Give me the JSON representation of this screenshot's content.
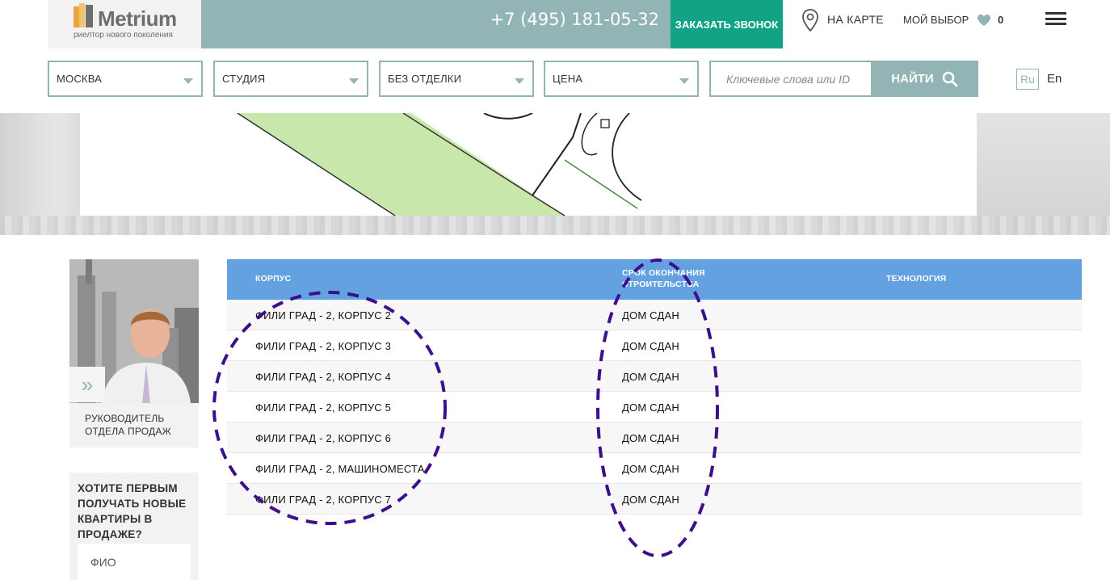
{
  "header": {
    "logo_name": "Metrium",
    "logo_tagline": "риелтор нового поколения",
    "phone": "+7 (495) 181-05-32",
    "call_button": "ЗАКАЗАТЬ ЗВОНОК",
    "map_link": "НА КАРТЕ",
    "my_choice": "МОЙ ВЫБОР",
    "choice_count": "0",
    "colors": {
      "teal": "#93b4b5",
      "green": "#12a286",
      "blue": "#64a1e0"
    }
  },
  "filters": {
    "city": "МОСКВА",
    "rooms": "СТУДИЯ",
    "finish": "БЕЗ ОТДЕЛКИ",
    "price": "ЦЕНА",
    "search_placeholder": "Ключевые слова или ID",
    "search_button": "НАЙТИ"
  },
  "lang": {
    "ru": "Ru",
    "en": "En"
  },
  "sidebar": {
    "manager_role": "РУКОВОДИТЕЛЬ ОТДЕЛА ПРОДАЖ",
    "subscribe_title": "ХОТИТЕ ПЕРВЫМ ПОЛУЧАТЬ НОВЫЕ КВАРТИРЫ В ПРОДАЖЕ?",
    "fio_placeholder": "ФИО"
  },
  "table": {
    "headers": [
      "КОРПУС",
      "СРОК ОКОНЧАНИЯ СТРОИТЕЛЬСТВА",
      "ТЕХНОЛОГИЯ"
    ],
    "rows": [
      {
        "building": "ФИЛИ ГРАД - 2, КОРПУС 2",
        "deadline": "ДОМ СДАН",
        "technology": ""
      },
      {
        "building": "ФИЛИ ГРАД - 2, КОРПУС 3",
        "deadline": "ДОМ СДАН",
        "technology": ""
      },
      {
        "building": "ФИЛИ ГРАД - 2, КОРПУС 4",
        "deadline": "ДОМ СДАН",
        "technology": ""
      },
      {
        "building": "ФИЛИ ГРАД - 2, КОРПУС 5",
        "deadline": "ДОМ СДАН",
        "technology": ""
      },
      {
        "building": "ФИЛИ ГРАД - 2, КОРПУС 6",
        "deadline": "ДОМ СДАН",
        "technology": ""
      },
      {
        "building": "ФИЛИ ГРАД - 2, МАШИНОМЕСТА",
        "deadline": "ДОМ СДАН",
        "technology": ""
      },
      {
        "building": "ФИЛИ ГРАД - 2, КОРПУС 7",
        "deadline": "ДОМ СДАН",
        "technology": ""
      }
    ]
  },
  "icons": [
    "logo-mark-icon",
    "map-pin-icon",
    "heart-icon",
    "hamburger-menu-icon",
    "dropdown-caret-icon",
    "search-icon",
    "double-chevron-right-icon"
  ]
}
